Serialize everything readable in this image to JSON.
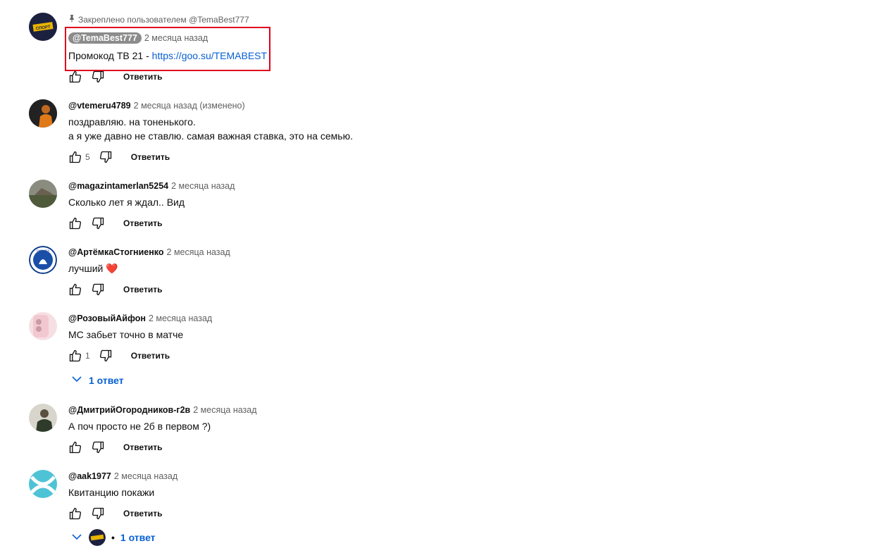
{
  "pinned_label": "Закреплено пользователем @TemaBest777",
  "reply_label": "Ответить",
  "comments": [
    {
      "author": "@TemaBest777",
      "time": "2 месяца назад",
      "text_prefix": "Промокод ТВ 21 - ",
      "link": "https://goo.su/TEMABEST",
      "avatar_text": "СПОРТ"
    },
    {
      "author": "@vtemeru4789",
      "time": "2 месяца назад (изменено)",
      "lines": [
        "поздравляю. на тоненького.",
        "а я уже давно не ставлю. самая важная ставка, это на семью."
      ],
      "likes": "5"
    },
    {
      "author": "@magazintamerlan5254",
      "time": "2 месяца назад",
      "text": "Сколько лет я ждал.. Вид"
    },
    {
      "author": "@АртёмкаСтогниенко",
      "time": "2 месяца назад",
      "text": "лучший ❤️",
      "avatar_text": "CHELSEA"
    },
    {
      "author": "@РозовыйАйфон",
      "time": "2 месяца назад",
      "text": "МС забьет точно в матче",
      "likes": "1",
      "replies": "1 ответ"
    },
    {
      "author": "@ДмитрийОгородников-г2в",
      "time": "2 месяца назад",
      "text": "А поч просто не 2б в первом ?)"
    },
    {
      "author": "@aak1977",
      "time": "2 месяца назад",
      "text": "Квитанцию покажи",
      "replies": "1 ответ"
    }
  ],
  "colors": {
    "link": "#065fd4",
    "highlight": "#e0001c",
    "meta": "#606060"
  }
}
